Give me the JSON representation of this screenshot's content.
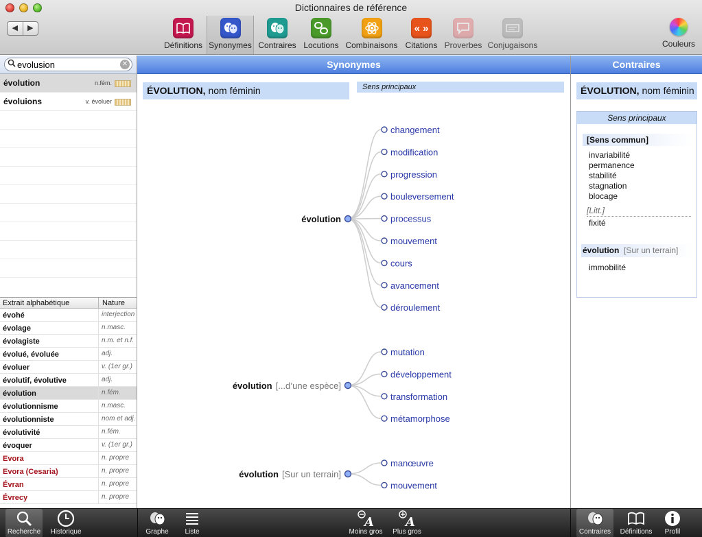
{
  "window": {
    "title": "Dictionnaires de référence"
  },
  "nav": {
    "back": "◀",
    "forward": "▶"
  },
  "toolbar": {
    "items": [
      {
        "label": "Définitions",
        "icon": "book-icon",
        "color": "#c3184f",
        "state": "normal"
      },
      {
        "label": "Synonymes",
        "icon": "masks-icon",
        "color": "#3457c9",
        "state": "active"
      },
      {
        "label": "Contraires",
        "icon": "masks-icon",
        "color": "#1f9c92",
        "state": "normal"
      },
      {
        "label": "Locutions",
        "icon": "links-icon",
        "color": "#4a9a2a",
        "state": "normal"
      },
      {
        "label": "Combinaisons",
        "icon": "atom-icon",
        "color": "#f0a012",
        "state": "normal"
      },
      {
        "label": "Citations",
        "icon": "quote-icon",
        "color": "#e8531c",
        "state": "normal"
      },
      {
        "label": "Proverbes",
        "icon": "speech-icon",
        "color": "#e8767a",
        "state": "disabled"
      },
      {
        "label": "Conjugaisons",
        "icon": "verb-icon",
        "color": "#9a9a9a",
        "state": "disabled"
      }
    ],
    "colors_label": "Couleurs"
  },
  "search": {
    "value": "evolusion",
    "placeholder": ""
  },
  "results": [
    {
      "word": "évolution",
      "nature": "n.fém.",
      "selected": true
    },
    {
      "word": "évoluions",
      "nature": "v. évoluer",
      "selected": false
    }
  ],
  "alpha": {
    "header_word": "Extrait alphabétique",
    "header_nature": "Nature",
    "rows": [
      {
        "word": "évohé",
        "nature": "interjection",
        "selected": false,
        "proper": false
      },
      {
        "word": "évolage",
        "nature": "n.masc.",
        "selected": false,
        "proper": false
      },
      {
        "word": "évolagiste",
        "nature": "n.m. et n.f.",
        "selected": false,
        "proper": false
      },
      {
        "word": "évolué, évoluée",
        "nature": "adj.",
        "selected": false,
        "proper": false
      },
      {
        "word": "évoluer",
        "nature": "v. (1er gr.)",
        "selected": false,
        "proper": false
      },
      {
        "word": "évolutif, évolutive",
        "nature": "adj.",
        "selected": false,
        "proper": false
      },
      {
        "word": "évolution",
        "nature": "n.fém.",
        "selected": true,
        "proper": false
      },
      {
        "word": "évolutionnisme",
        "nature": "n.masc.",
        "selected": false,
        "proper": false
      },
      {
        "word": "évolutionniste",
        "nature": "nom et adj.",
        "selected": false,
        "proper": false
      },
      {
        "word": "évolutivité",
        "nature": "n.fém.",
        "selected": false,
        "proper": false
      },
      {
        "word": "évoquer",
        "nature": "v. (1er gr.)",
        "selected": false,
        "proper": false
      },
      {
        "word": "Evora",
        "nature": "n. propre",
        "selected": false,
        "proper": true
      },
      {
        "word": "Evora (Cesaria)",
        "nature": "n. propre",
        "selected": false,
        "proper": true
      },
      {
        "word": "Évran",
        "nature": "n. propre",
        "selected": false,
        "proper": true
      },
      {
        "word": "Évrecy",
        "nature": "n. propre",
        "selected": false,
        "proper": true
      }
    ]
  },
  "center": {
    "header": "Synonymes",
    "entry_word": "ÉVOLUTION,",
    "entry_nature": "nom féminin",
    "sens": "Sens principaux",
    "groups": [
      {
        "label": "évolution",
        "qualifier": "",
        "synonyms": [
          "changement",
          "modification",
          "progression",
          "bouleversement",
          "processus",
          "mouvement",
          "cours",
          "avancement",
          "déroulement"
        ]
      },
      {
        "label": "évolution",
        "qualifier": "[...d’une espèce]",
        "synonyms": [
          "mutation",
          "développement",
          "transformation",
          "métamorphose"
        ]
      },
      {
        "label": "évolution",
        "qualifier": "[Sur un terrain]",
        "synonyms": [
          "manœuvre",
          "mouvement"
        ]
      }
    ]
  },
  "right": {
    "header": "Contraires",
    "entry_word": "ÉVOLUTION,",
    "entry_nature": "nom féminin",
    "sens": "Sens principaux",
    "sens_commun": "[Sens commun]",
    "antonyms": [
      "invariabilité",
      "permanence",
      "stabilité",
      "stagnation",
      "blocage"
    ],
    "litt": "[Litt.]",
    "litt_word": "fixité",
    "terrain_word": "évolution",
    "terrain_tag": "[Sur un terrain]",
    "terrain_ant": "immobilité"
  },
  "bottom": {
    "left": [
      {
        "label": "Recherche",
        "icon": "magnifier-icon"
      },
      {
        "label": "Historique",
        "icon": "clock-icon"
      }
    ],
    "center": [
      {
        "label": "Graphe",
        "icon": "masks-icon"
      },
      {
        "label": "Liste",
        "icon": "list-icon"
      }
    ],
    "zoom": [
      {
        "label": "Moins gros",
        "icon": "zoom-out-icon"
      },
      {
        "label": "Plus gros",
        "icon": "zoom-in-icon"
      }
    ],
    "right": [
      {
        "label": "Contraires",
        "icon": "masks-icon"
      },
      {
        "label": "Définitions",
        "icon": "book-icon"
      },
      {
        "label": "Profil",
        "icon": "info-icon"
      }
    ]
  },
  "colors": {
    "accent": "#4d7fe0",
    "link": "#2a3aa8",
    "entry_bg": "#c9dcf7"
  }
}
